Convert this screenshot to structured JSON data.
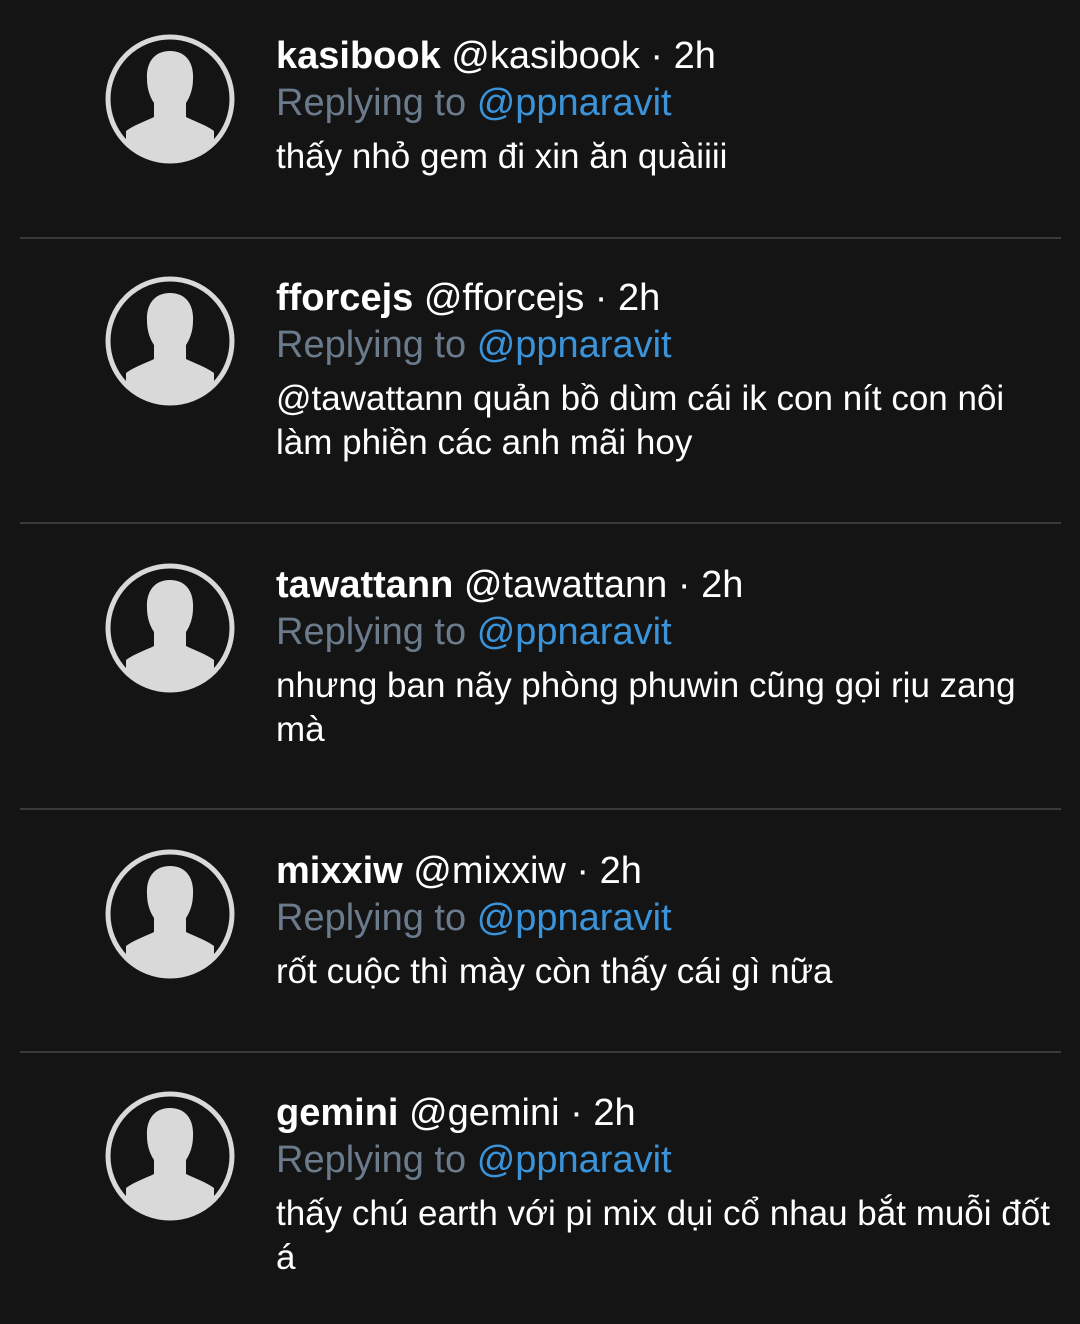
{
  "replies": [
    {
      "name": "kasibook",
      "handle": "@kasibook",
      "separator": "·",
      "time": "2h",
      "replying_prefix": "Replying to",
      "replying_handle": "@ppnaravit",
      "text": "thấy nhỏ gem đi xin ăn quàiiii"
    },
    {
      "name": "fforcejs",
      "handle": "@fforcejs",
      "separator": "·",
      "time": "2h",
      "replying_prefix": "Replying to",
      "replying_handle": "@ppnaravit",
      "text": "@tawattann quản bồ dùm cái ik con nít con nôi làm phiền các anh mãi hoy"
    },
    {
      "name": "tawattann",
      "handle": "@tawattann",
      "separator": "·",
      "time": "2h",
      "replying_prefix": "Replying to",
      "replying_handle": "@ppnaravit",
      "text": "nhưng ban nãy phòng phuwin cũng gọi rịu zang mà"
    },
    {
      "name": "mixxiw",
      "handle": "@mixxiw",
      "separator": "·",
      "time": "2h",
      "replying_prefix": "Replying to",
      "replying_handle": "@ppnaravit",
      "text": "rốt cuộc thì mày còn thấy cái gì nữa"
    },
    {
      "name": "gemini",
      "handle": "@gemini",
      "separator": "·",
      "time": "2h",
      "replying_prefix": "Replying to",
      "replying_handle": "@ppnaravit",
      "text": "thấy chú earth với pi mix dụi cổ nhau bắt muỗi đốt á"
    }
  ],
  "colors": {
    "background": "#141414",
    "text": "#ffffff",
    "muted": "#6b7b8c",
    "link": "#3b94d9",
    "avatar": "#d9d9d9",
    "divider": "#3a3a3a"
  },
  "icons": {
    "avatar": "default-profile-silhouette-icon"
  }
}
